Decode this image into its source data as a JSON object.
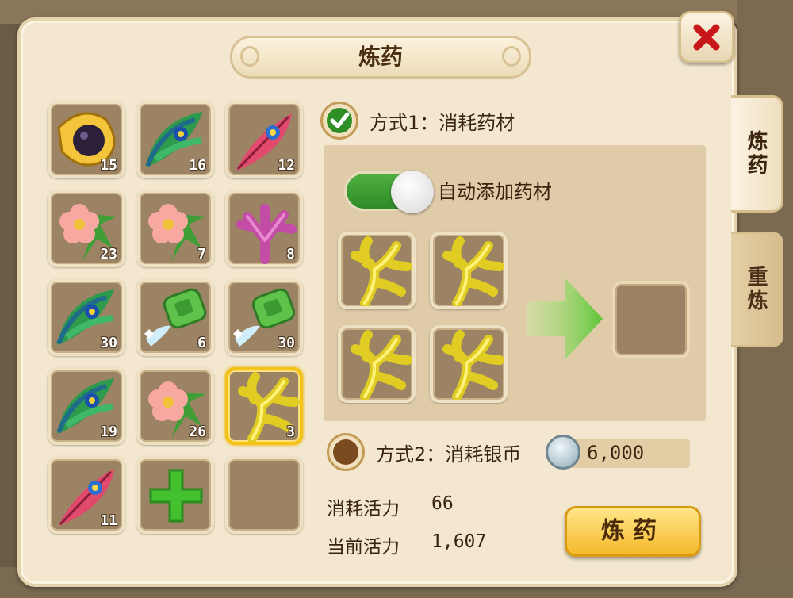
{
  "window": {
    "title": "炼药",
    "close_icon": "close-icon"
  },
  "tabs": [
    {
      "label": "炼药",
      "active": true
    },
    {
      "label": "重炼",
      "active": false
    }
  ],
  "inventory": [
    {
      "icon": "black-pearl-icon",
      "count": "15"
    },
    {
      "icon": "peacock-feather-icon",
      "count": "16"
    },
    {
      "icon": "red-feather-icon",
      "count": "12"
    },
    {
      "icon": "flower-icon",
      "count": "23"
    },
    {
      "icon": "flower-icon",
      "count": "7"
    },
    {
      "icon": "coral-icon",
      "count": "8"
    },
    {
      "icon": "peacock-feather-icon",
      "count": "30"
    },
    {
      "icon": "jade-icon",
      "count": "6"
    },
    {
      "icon": "jade-icon",
      "count": "30"
    },
    {
      "icon": "peacock-feather-icon",
      "count": "19"
    },
    {
      "icon": "flower-icon",
      "count": "26"
    },
    {
      "icon": "yellow-coral-icon",
      "count": "3",
      "selected": true
    },
    {
      "icon": "red-feather-icon",
      "count": "11"
    },
    {
      "icon": "add-icon",
      "count": ""
    },
    {
      "icon": "empty-slot",
      "count": ""
    }
  ],
  "mode1": {
    "label": "方式1：消耗药材",
    "checked": true
  },
  "auto_add": {
    "label": "自动添加药材",
    "on": true
  },
  "ingredient_slots": [
    "yellow-coral-icon",
    "yellow-coral-icon",
    "yellow-coral-icon",
    "yellow-coral-icon"
  ],
  "mode2": {
    "label": "方式2：消耗银币",
    "cost": "6,000",
    "coin_icon": "silver-coin-icon"
  },
  "stats": {
    "consume_label": "消耗活力",
    "consume_value": "66",
    "current_label": "当前活力",
    "current_value": "1,607"
  },
  "refine_button": "炼药",
  "colors": {
    "accent_green": "#2e8a27",
    "button_gold": "#f5b92a",
    "panel": "#f3e8cf"
  }
}
